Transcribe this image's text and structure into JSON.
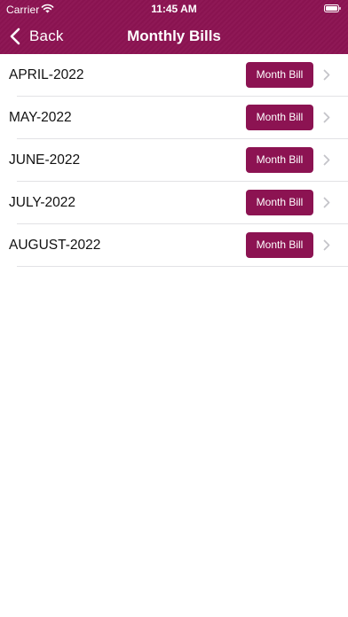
{
  "status_bar": {
    "carrier": "Carrier",
    "time": "11:45 AM",
    "wifi_icon": "wifi-icon",
    "battery_icon": "battery-icon"
  },
  "nav": {
    "back_label": "Back",
    "title": "Monthly Bills",
    "back_icon": "chevron-left-icon"
  },
  "colors": {
    "accent": "#8c1352",
    "divider": "#e2e2e5",
    "chevron": "#c4c4c9"
  },
  "bills": [
    {
      "month": "APRIL-2022",
      "button_label": "Month Bill"
    },
    {
      "month": "MAY-2022",
      "button_label": "Month Bill"
    },
    {
      "month": "JUNE-2022",
      "button_label": "Month Bill"
    },
    {
      "month": "JULY-2022",
      "button_label": "Month Bill"
    },
    {
      "month": "AUGUST-2022",
      "button_label": "Month Bill"
    }
  ]
}
